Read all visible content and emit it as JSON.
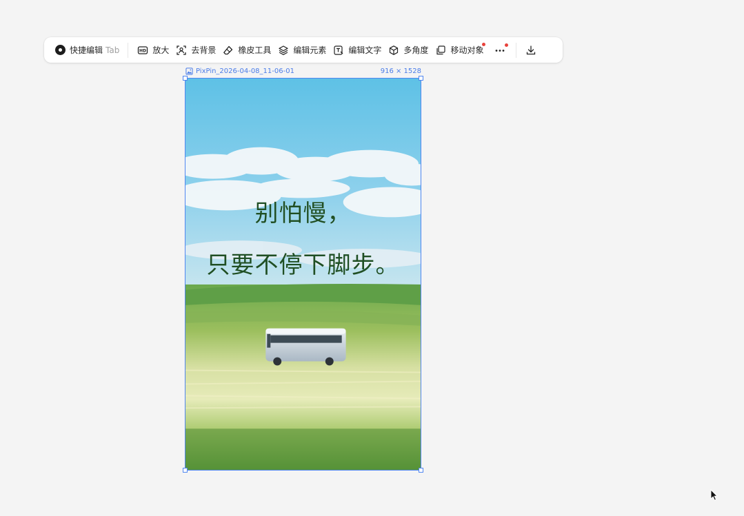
{
  "toolbar": {
    "quick_edit": {
      "label": "快捷编辑",
      "shortcut": "Tab",
      "icon": "logo-icon"
    },
    "items": [
      {
        "id": "upscale",
        "label": "放大",
        "icon": "hd-icon"
      },
      {
        "id": "remove-bg",
        "label": "去背景",
        "icon": "remove-background-icon"
      },
      {
        "id": "eraser",
        "label": "橡皮工具",
        "icon": "eraser-icon"
      },
      {
        "id": "edit-elements",
        "label": "编辑元素",
        "icon": "layers-icon"
      },
      {
        "id": "edit-text",
        "label": "编辑文字",
        "icon": "text-edit-icon"
      },
      {
        "id": "multi-angle",
        "label": "多角度",
        "icon": "cube-icon"
      },
      {
        "id": "move-object",
        "label": "移动对象",
        "icon": "move-object-icon",
        "notification": true
      }
    ],
    "more": {
      "icon": "more-icon",
      "notification": true
    },
    "download": {
      "icon": "download-icon"
    }
  },
  "canvas": {
    "filename": "PixPin_2026-04-08_11-06-01",
    "dimensions": "916 × 1528",
    "image_icon": "image-icon",
    "quote_line1": "别怕慢，",
    "quote_line2": "只要不停下脚步。"
  },
  "colors": {
    "selection": "#4f86f0",
    "notification": "#e8423b",
    "quote_text": "#1f4f24"
  }
}
